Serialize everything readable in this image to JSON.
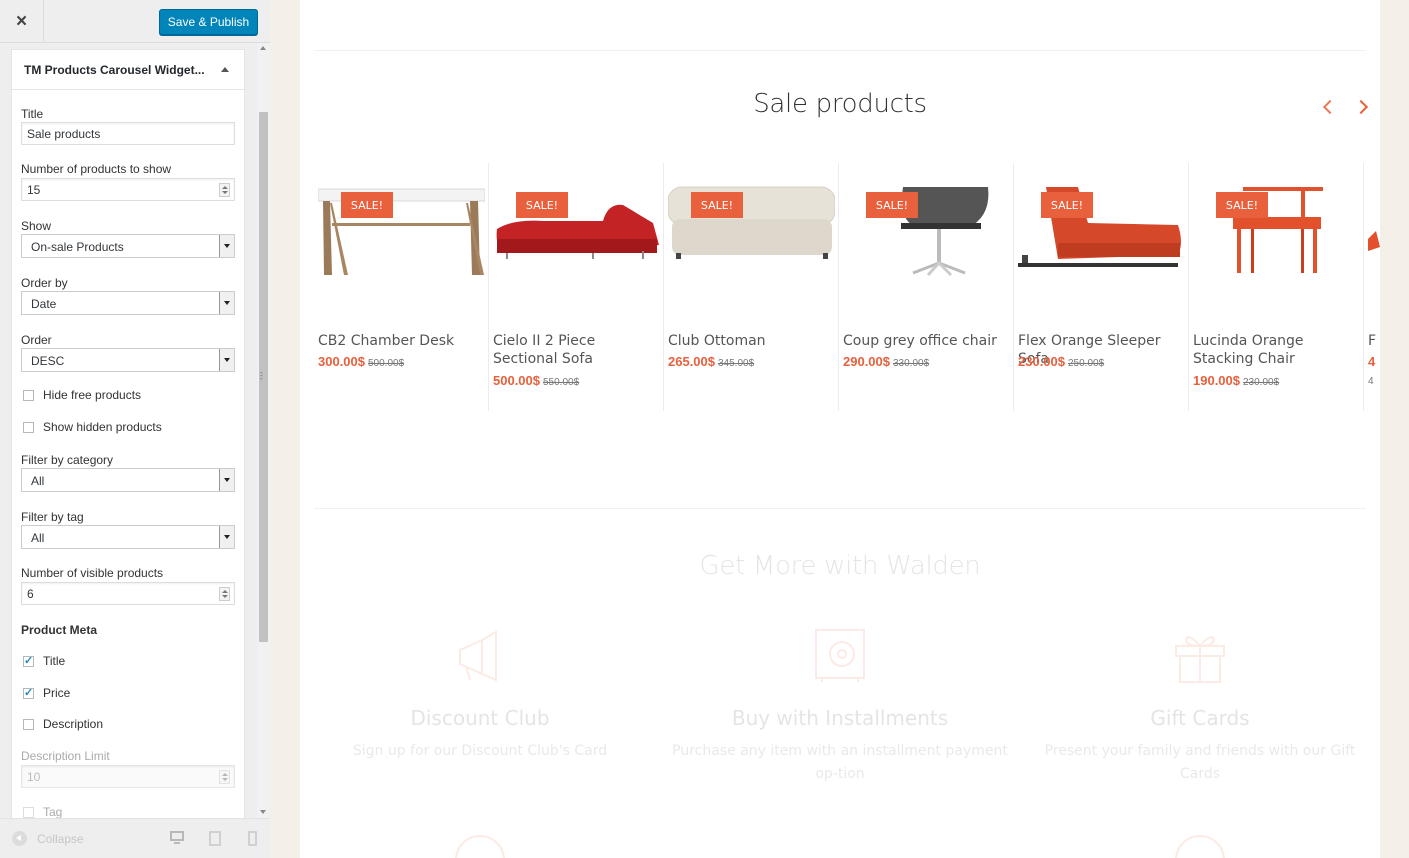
{
  "header": {
    "close_icon": "×",
    "publish_label": "Save & Publish"
  },
  "widget": {
    "title": "TM Products Carousel Widget...",
    "fields": {
      "title_label": "Title",
      "title_value": "Sale products",
      "num_products_label": "Number of products to show",
      "num_products_value": "15",
      "show_label": "Show",
      "show_value": "On-sale Products",
      "orderby_label": "Order by",
      "orderby_value": "Date",
      "order_label": "Order",
      "order_value": "DESC",
      "hide_free_label": "Hide free products",
      "show_hidden_label": "Show hidden products",
      "filter_cat_label": "Filter by category",
      "filter_cat_value": "All",
      "filter_tag_label": "Filter by tag",
      "filter_tag_value": "All",
      "visible_label": "Number of visible products",
      "visible_value": "6",
      "meta_heading": "Product Meta",
      "meta_title_label": "Title",
      "meta_price_label": "Price",
      "meta_desc_label": "Description",
      "desc_limit_label": "Description Limit",
      "desc_limit_value": "10",
      "tag_label": "Tag"
    }
  },
  "footer": {
    "collapse_label": "Collapse"
  },
  "preview": {
    "section_title": "Sale products",
    "badge": "SALE!",
    "products": [
      {
        "name": "CB2 Chamber Desk",
        "price": "300.00$",
        "old": "500.00$"
      },
      {
        "name": "Cielo II 2 Piece Sectional Sofa",
        "price": "500.00$",
        "old": "550.00$"
      },
      {
        "name": "Club Ottoman",
        "price": "265.00$",
        "old": "345.00$"
      },
      {
        "name": "Coup grey office chair",
        "price": "290.00$",
        "old": "330.00$"
      },
      {
        "name": "Flex Orange Sleeper Sofa",
        "price": "230.00$",
        "old": "250.00$"
      },
      {
        "name": "Lucinda Orange Stacking Chair",
        "price": "190.00$",
        "old": "230.00$"
      },
      {
        "name": "F",
        "price": "4",
        "old": "4"
      }
    ],
    "more_title": "Get More with Walden",
    "features": [
      {
        "title": "Discount Club",
        "desc": "Sign up for our Discount Club's Card"
      },
      {
        "title": "Buy with Installments",
        "desc": "Purchase any item with an installment payment op-tion"
      },
      {
        "title": "Gift Cards",
        "desc": "Present your family and friends with our Gift Cards"
      }
    ]
  },
  "colors": {
    "accent": "#e8603c",
    "publish": "#0085ba"
  }
}
